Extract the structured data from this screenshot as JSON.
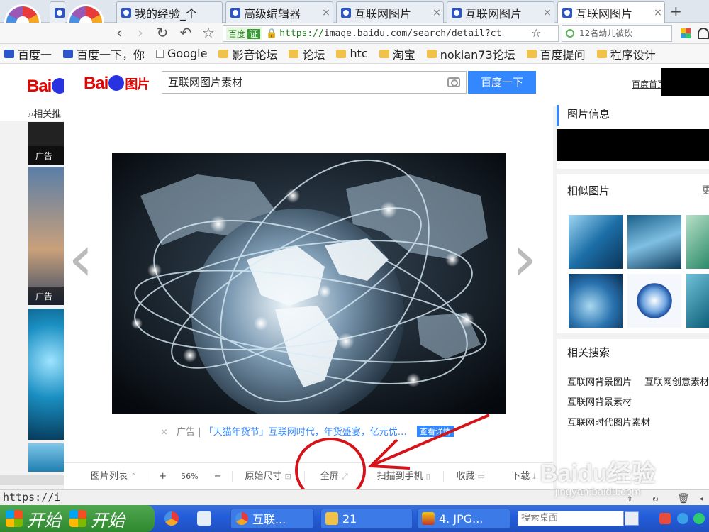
{
  "browser": {
    "tabs": [
      {
        "label": "我的经验_个"
      },
      {
        "label": "高级编辑器"
      },
      {
        "label": "互联网图片"
      },
      {
        "label": "互联网图片"
      },
      {
        "label": "互联网图片"
      }
    ],
    "close_glyph": "×",
    "new_tab_glyph": "+",
    "nav": {
      "back": "‹",
      "forward": "›",
      "refresh": "↻",
      "undo": "↶",
      "star": "☆"
    },
    "url": {
      "verify_text": "百度",
      "verify_badge": "证",
      "scheme": "https://",
      "rest": "image.baidu.com/search/detail?ct"
    },
    "search_placeholder": "12名幼儿被砍",
    "bookmarks": [
      {
        "label": "百度一",
        "icon": "baidu-paw-icon"
      },
      {
        "label": "百度一下，你",
        "icon": "baidu-paw-icon"
      },
      {
        "label": "Google",
        "icon": "page-icon"
      },
      {
        "label": "影音论坛",
        "icon": "folder-icon"
      },
      {
        "label": "论坛",
        "icon": "folder-icon"
      },
      {
        "label": "htc",
        "icon": "folder-icon"
      },
      {
        "label": "淘宝",
        "icon": "folder-icon"
      },
      {
        "label": "nokian73论坛",
        "icon": "folder-icon"
      },
      {
        "label": "百度提问",
        "icon": "folder-icon"
      },
      {
        "label": "程序设计",
        "icon": "folder-icon"
      }
    ]
  },
  "page": {
    "logo_text_a": "Bai",
    "logo_text_b": "du",
    "logo_pic": "图片",
    "related_label": "相关推",
    "ad_label": "广告",
    "top_right_link": "百度首页"
  },
  "modal": {
    "search_value": "互联网图片素材",
    "search_button": "百度一下",
    "prev_glyph": "‹",
    "next_glyph": "›",
    "ad": {
      "close": "×",
      "prefix": "广告 |",
      "text": "「天猫年货节」互联网时代，年货盛宴，亿元优…",
      "button": "查看详情"
    },
    "toolbar": {
      "list": "图片列表",
      "zoom_in": "+",
      "zoom": "56%",
      "zoom_out": "−",
      "original": "原始尺寸",
      "fullscreen": "全屏",
      "scan": "扫描到手机",
      "collect": "收藏",
      "download": "下载"
    }
  },
  "sidebar": {
    "info_title": "图片信息",
    "similar_title": "相似图片",
    "similar_more": "更",
    "related_title": "相关搜索",
    "related": [
      "互联网背景图片",
      "互联网创意素材",
      "互联网背景素材",
      "互联网时代图片素材"
    ]
  },
  "status": {
    "text": "https://i"
  },
  "taskbar": {
    "start": "开始",
    "tasks": [
      "互联...",
      "21",
      "4. JPG..."
    ],
    "desk_search": "搜索桌面"
  },
  "watermark": {
    "main": "Baidu经验",
    "sub": "jingyan.baidu.com"
  },
  "colors": {
    "accent": "#3388ff",
    "annotation": "#d4141a",
    "baidu_red": "#e10602",
    "taskbar": "#245edb"
  }
}
